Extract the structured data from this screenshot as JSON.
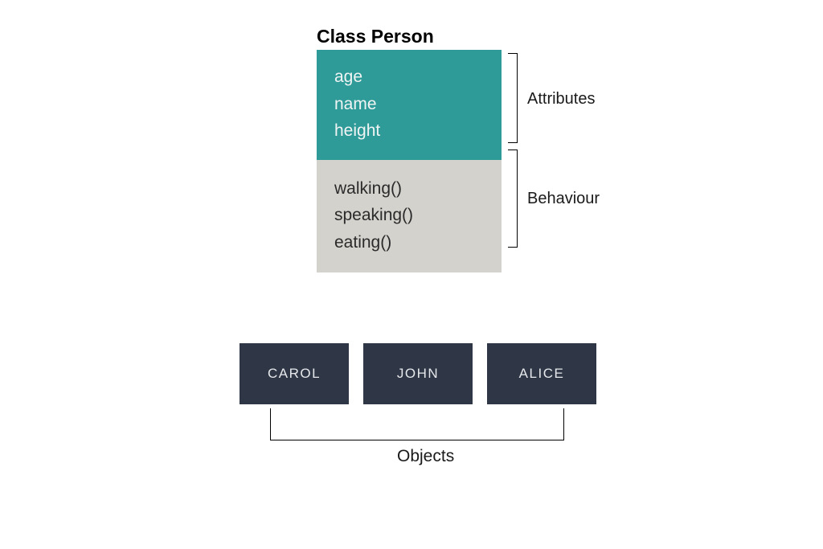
{
  "class": {
    "title": "Class Person",
    "attributes": {
      "label": "Attributes",
      "items": [
        "age",
        "name",
        "height"
      ]
    },
    "behaviour": {
      "label": "Behaviour",
      "items": [
        "walking()",
        "speaking()",
        "eating()"
      ]
    }
  },
  "objects": {
    "label": "Objects",
    "items": [
      "CAROL",
      "JOHN",
      "ALICE"
    ]
  }
}
